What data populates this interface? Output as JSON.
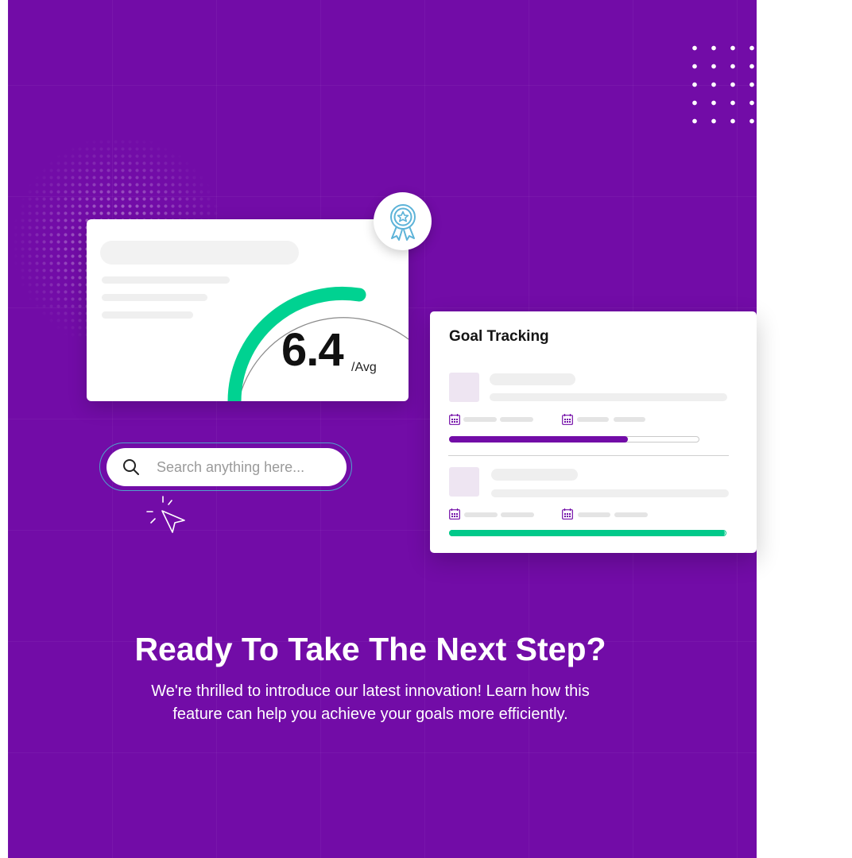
{
  "score_card": {
    "value": "6.4",
    "unit": "/Avg",
    "gauge_progress": 0.64
  },
  "badge": {
    "icon": "award-ribbon-icon"
  },
  "search": {
    "placeholder": "Search anything here...",
    "icon": "search-icon"
  },
  "goal_tracking": {
    "title": "Goal Tracking",
    "goals": [
      {
        "progress": 0.72,
        "color": "#720ca7"
      },
      {
        "progress": 1.0,
        "color": "#00c98a"
      }
    ]
  },
  "cta": {
    "headline": "Ready To Take The Next Step?",
    "line1": "We're thrilled to introduce our latest innovation! Learn how this",
    "line2": "feature can help you achieve your goals more efficiently."
  },
  "colors": {
    "background": "#720ca7",
    "accent_green": "#00d291",
    "accent_purple": "#720ca7",
    "badge_icon": "#5db3d8"
  }
}
